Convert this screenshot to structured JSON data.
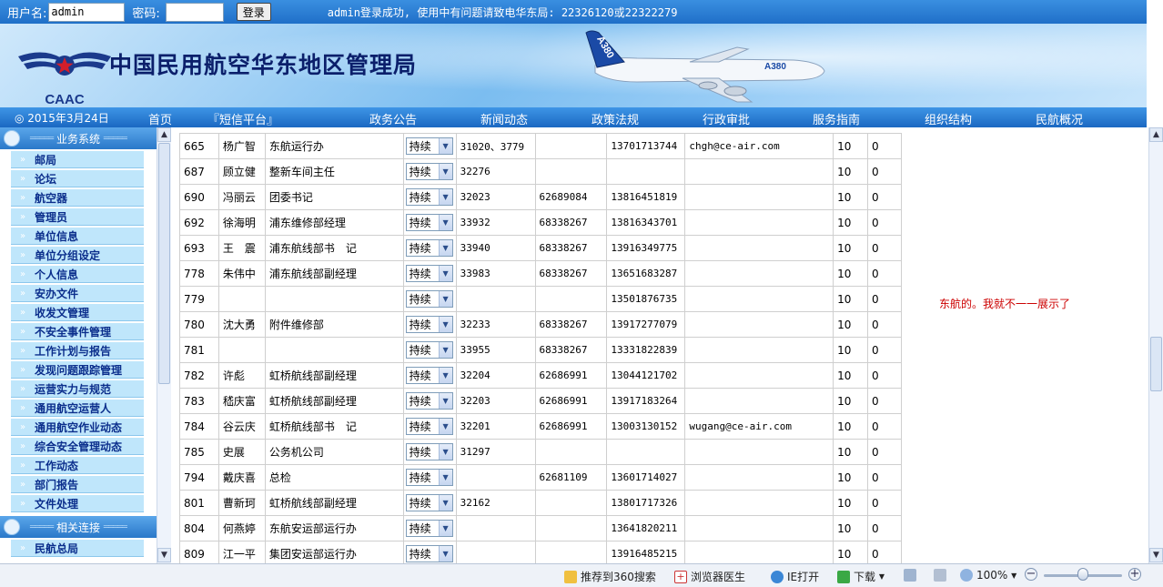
{
  "login": {
    "username_label": "用户名:",
    "username_value": "admin",
    "password_label": "密码:",
    "password_value": "",
    "login_button": "登录",
    "message": "admin登录成功, 使用中有问题请致电华东局: 22326120或22322279"
  },
  "banner": {
    "title": "中国民用航空华东地区管理局",
    "logo_text": "CAAC",
    "plane_text": "A380"
  },
  "nav": {
    "date": "◎ 2015年3月24日",
    "items": [
      "首页",
      "『短信平台』",
      "政务公告",
      "新闻动态",
      "政策法规",
      "行政审批",
      "服务指南",
      "组织结构",
      "民航概况"
    ]
  },
  "sidebar": {
    "section1": "业务系统",
    "items": [
      "邮局",
      "论坛",
      "航空器",
      "管理员",
      "单位信息",
      "单位分组设定",
      "个人信息",
      "安办文件",
      "收发文管理",
      "不安全事件管理",
      "工作计划与报告",
      "发现问题跟踪管理",
      "运营实力与规范",
      "通用航空运营人",
      "通用航空作业动态",
      "综合安全管理动态",
      "工作动态",
      "部门报告",
      "文件处理"
    ],
    "section2": "相关连接",
    "links": [
      "民航总局"
    ]
  },
  "table": {
    "status_option": "持续",
    "rows": [
      {
        "id": "665",
        "name": "杨广智",
        "position": "东航运行办",
        "ext": "31020、3779",
        "tel": "",
        "mobile": "13701713744",
        "email": "chgh@ce-air.com",
        "n1": "10",
        "n2": "0"
      },
      {
        "id": "687",
        "name": "顾立健",
        "position": "整新车间主任",
        "ext": "32276",
        "tel": "",
        "mobile": "",
        "email": "",
        "n1": "10",
        "n2": "0"
      },
      {
        "id": "690",
        "name": "冯丽云",
        "position": "团委书记",
        "ext": "32023",
        "tel": "62689084",
        "mobile": "13816451819",
        "email": "",
        "n1": "10",
        "n2": "0"
      },
      {
        "id": "692",
        "name": "徐海明",
        "position": "浦东维修部经理",
        "ext": "33932",
        "tel": "68338267",
        "mobile": "13816343701",
        "email": "",
        "n1": "10",
        "n2": "0"
      },
      {
        "id": "693",
        "name": "王　震",
        "position": "浦东航线部书　记",
        "ext": "33940",
        "tel": "68338267",
        "mobile": "13916349775",
        "email": "",
        "n1": "10",
        "n2": "0"
      },
      {
        "id": "778",
        "name": "朱伟中",
        "position": "浦东航线部副经理",
        "ext": "33983",
        "tel": "68338267",
        "mobile": "13651683287",
        "email": "",
        "n1": "10",
        "n2": "0"
      },
      {
        "id": "779",
        "name": "",
        "position": "",
        "ext": "",
        "tel": "",
        "mobile": "13501876735",
        "email": "",
        "n1": "10",
        "n2": "0"
      },
      {
        "id": "780",
        "name": "沈大勇",
        "position": "附件维修部",
        "ext": "32233",
        "tel": "68338267",
        "mobile": "13917277079",
        "email": "",
        "n1": "10",
        "n2": "0"
      },
      {
        "id": "781",
        "name": "",
        "position": "",
        "ext": "33955",
        "tel": "68338267",
        "mobile": "13331822839",
        "email": "",
        "n1": "10",
        "n2": "0"
      },
      {
        "id": "782",
        "name": "许彪",
        "position": "虹桥航线部副经理",
        "ext": "32204",
        "tel": "62686991",
        "mobile": "13044121702",
        "email": "",
        "n1": "10",
        "n2": "0"
      },
      {
        "id": "783",
        "name": "嵇庆富",
        "position": "虹桥航线部副经理",
        "ext": "32203",
        "tel": "62686991",
        "mobile": "13917183264",
        "email": "",
        "n1": "10",
        "n2": "0"
      },
      {
        "id": "784",
        "name": "谷云庆",
        "position": "虹桥航线部书　记",
        "ext": "32201",
        "tel": "62686991",
        "mobile": "13003130152",
        "email": "wugang@ce-air.com",
        "n1": "10",
        "n2": "0"
      },
      {
        "id": "785",
        "name": "史展",
        "position": "公务机公司",
        "ext": "31297",
        "tel": "",
        "mobile": "",
        "email": "",
        "n1": "10",
        "n2": "0"
      },
      {
        "id": "794",
        "name": "戴庆喜",
        "position": "总检",
        "ext": "",
        "tel": "62681109",
        "mobile": "13601714027",
        "email": "",
        "n1": "10",
        "n2": "0"
      },
      {
        "id": "801",
        "name": "曹新珂",
        "position": "虹桥航线部副经理",
        "ext": "32162",
        "tel": "",
        "mobile": "13801717326",
        "email": "",
        "n1": "10",
        "n2": "0"
      },
      {
        "id": "804",
        "name": "何燕婷",
        "position": "东航安运部运行办",
        "ext": "",
        "tel": "",
        "mobile": "13641820211",
        "email": "",
        "n1": "10",
        "n2": "0"
      },
      {
        "id": "809",
        "name": "江一平",
        "position": "集团安运部运行办",
        "ext": "",
        "tel": "",
        "mobile": "13916485215",
        "email": "",
        "n1": "10",
        "n2": "0"
      }
    ]
  },
  "note": "东航的。我就不一一展示了",
  "statusbar": {
    "recommend": "推荐到360搜索",
    "doctor": "浏览器医生",
    "ie_open": "IE打开",
    "download": "下载",
    "zoom": "100%"
  },
  "colors": {
    "bar_blue": "#1f6fc8",
    "sidebar_item": "#bfe6fb",
    "sidebar_text": "#0b2e8c",
    "note_red": "#cc0000"
  }
}
